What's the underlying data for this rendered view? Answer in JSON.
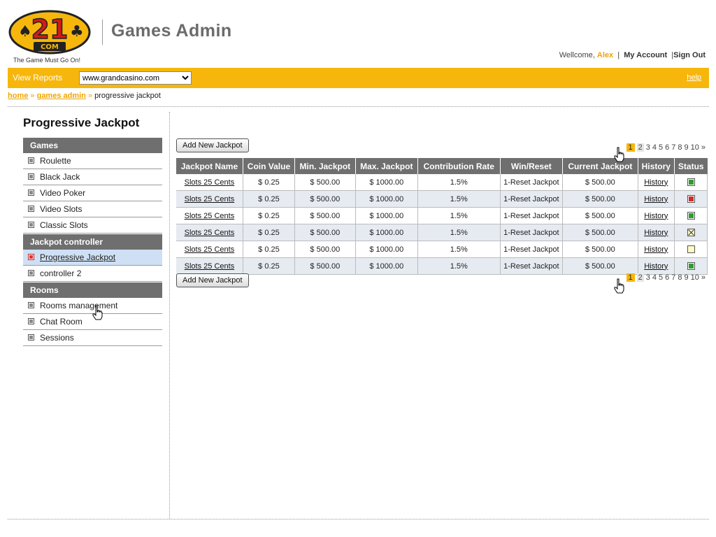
{
  "header": {
    "logo_text": "21",
    "logo_sub": "COM",
    "tagline": "The Game Must Go On!",
    "app_title": "Games Admin",
    "welcome": "Wellcome,",
    "username": "Alex",
    "my_account": "My Account",
    "sign_out": "Sign Out"
  },
  "toolbar": {
    "view_reports": "View Reports",
    "site_select": "www.grandcasino.com",
    "help": "help"
  },
  "breadcrumb": {
    "home": "home",
    "games_admin": "games admin",
    "current": "progressive jackpot",
    "separator": "»"
  },
  "page_title": "Progressive Jackpot",
  "sidebar": {
    "games_header": "Games",
    "games": [
      "Roulette",
      "Black Jack",
      "Video Poker",
      "Video Slots",
      "Classic Slots"
    ],
    "jackpot_header": "Jackpot controller",
    "jackpot": [
      "Progressive Jackpot",
      "controller 2"
    ],
    "rooms_header": "Rooms",
    "rooms": [
      "Rooms management",
      "Chat Room",
      "Sessions"
    ]
  },
  "add_button": "Add New Jackpot",
  "pager": {
    "pages": [
      "1",
      "2",
      "3",
      "4",
      "5",
      "6",
      "7",
      "8",
      "9",
      "10"
    ],
    "next": "»"
  },
  "table": {
    "headers": [
      "Jackpot Name",
      "Coin Value",
      "Min. Jackpot",
      "Max. Jackpot",
      "Contribution Rate",
      "Win/Reset",
      "Current Jackpot",
      "History",
      "Status"
    ],
    "rows": [
      {
        "name": "Slots 25 Cents",
        "coin": "$ 0.25",
        "min": "$ 500.00",
        "max": "$ 1000.00",
        "rate": "1.5%",
        "win": "1-Reset Jackpot",
        "current": "$ 500.00",
        "history": "History",
        "status": "green"
      },
      {
        "name": "Slots 25 Cents",
        "coin": "$ 0.25",
        "min": "$ 500.00",
        "max": "$ 1000.00",
        "rate": "1.5%",
        "win": "1-Reset Jackpot",
        "current": "$ 500.00",
        "history": "History",
        "status": "red"
      },
      {
        "name": "Slots 25 Cents",
        "coin": "$ 0.25",
        "min": "$ 500.00",
        "max": "$ 1000.00",
        "rate": "1.5%",
        "win": "1-Reset Jackpot",
        "current": "$ 500.00",
        "history": "History",
        "status": "green"
      },
      {
        "name": "Slots 25 Cents",
        "coin": "$ 0.25",
        "min": "$ 500.00",
        "max": "$ 1000.00",
        "rate": "1.5%",
        "win": "1-Reset Jackpot",
        "current": "$ 500.00",
        "history": "History",
        "status": "x"
      },
      {
        "name": "Slots 25 Cents",
        "coin": "$ 0.25",
        "min": "$ 500.00",
        "max": "$ 1000.00",
        "rate": "1.5%",
        "win": "1-Reset Jackpot",
        "current": "$ 500.00",
        "history": "History",
        "status": "empty"
      },
      {
        "name": "Slots 25 Cents",
        "coin": "$ 0.25",
        "min": "$ 500.00",
        "max": "$ 1000.00",
        "rate": "1.5%",
        "win": "1-Reset Jackpot",
        "current": "$ 500.00",
        "history": "History",
        "status": "green"
      }
    ]
  },
  "colors": {
    "accent": "#f6b60c",
    "header_gray": "#6f6f6f",
    "row_alt": "#e6ebf2",
    "active_item": "#cfe0f4"
  }
}
